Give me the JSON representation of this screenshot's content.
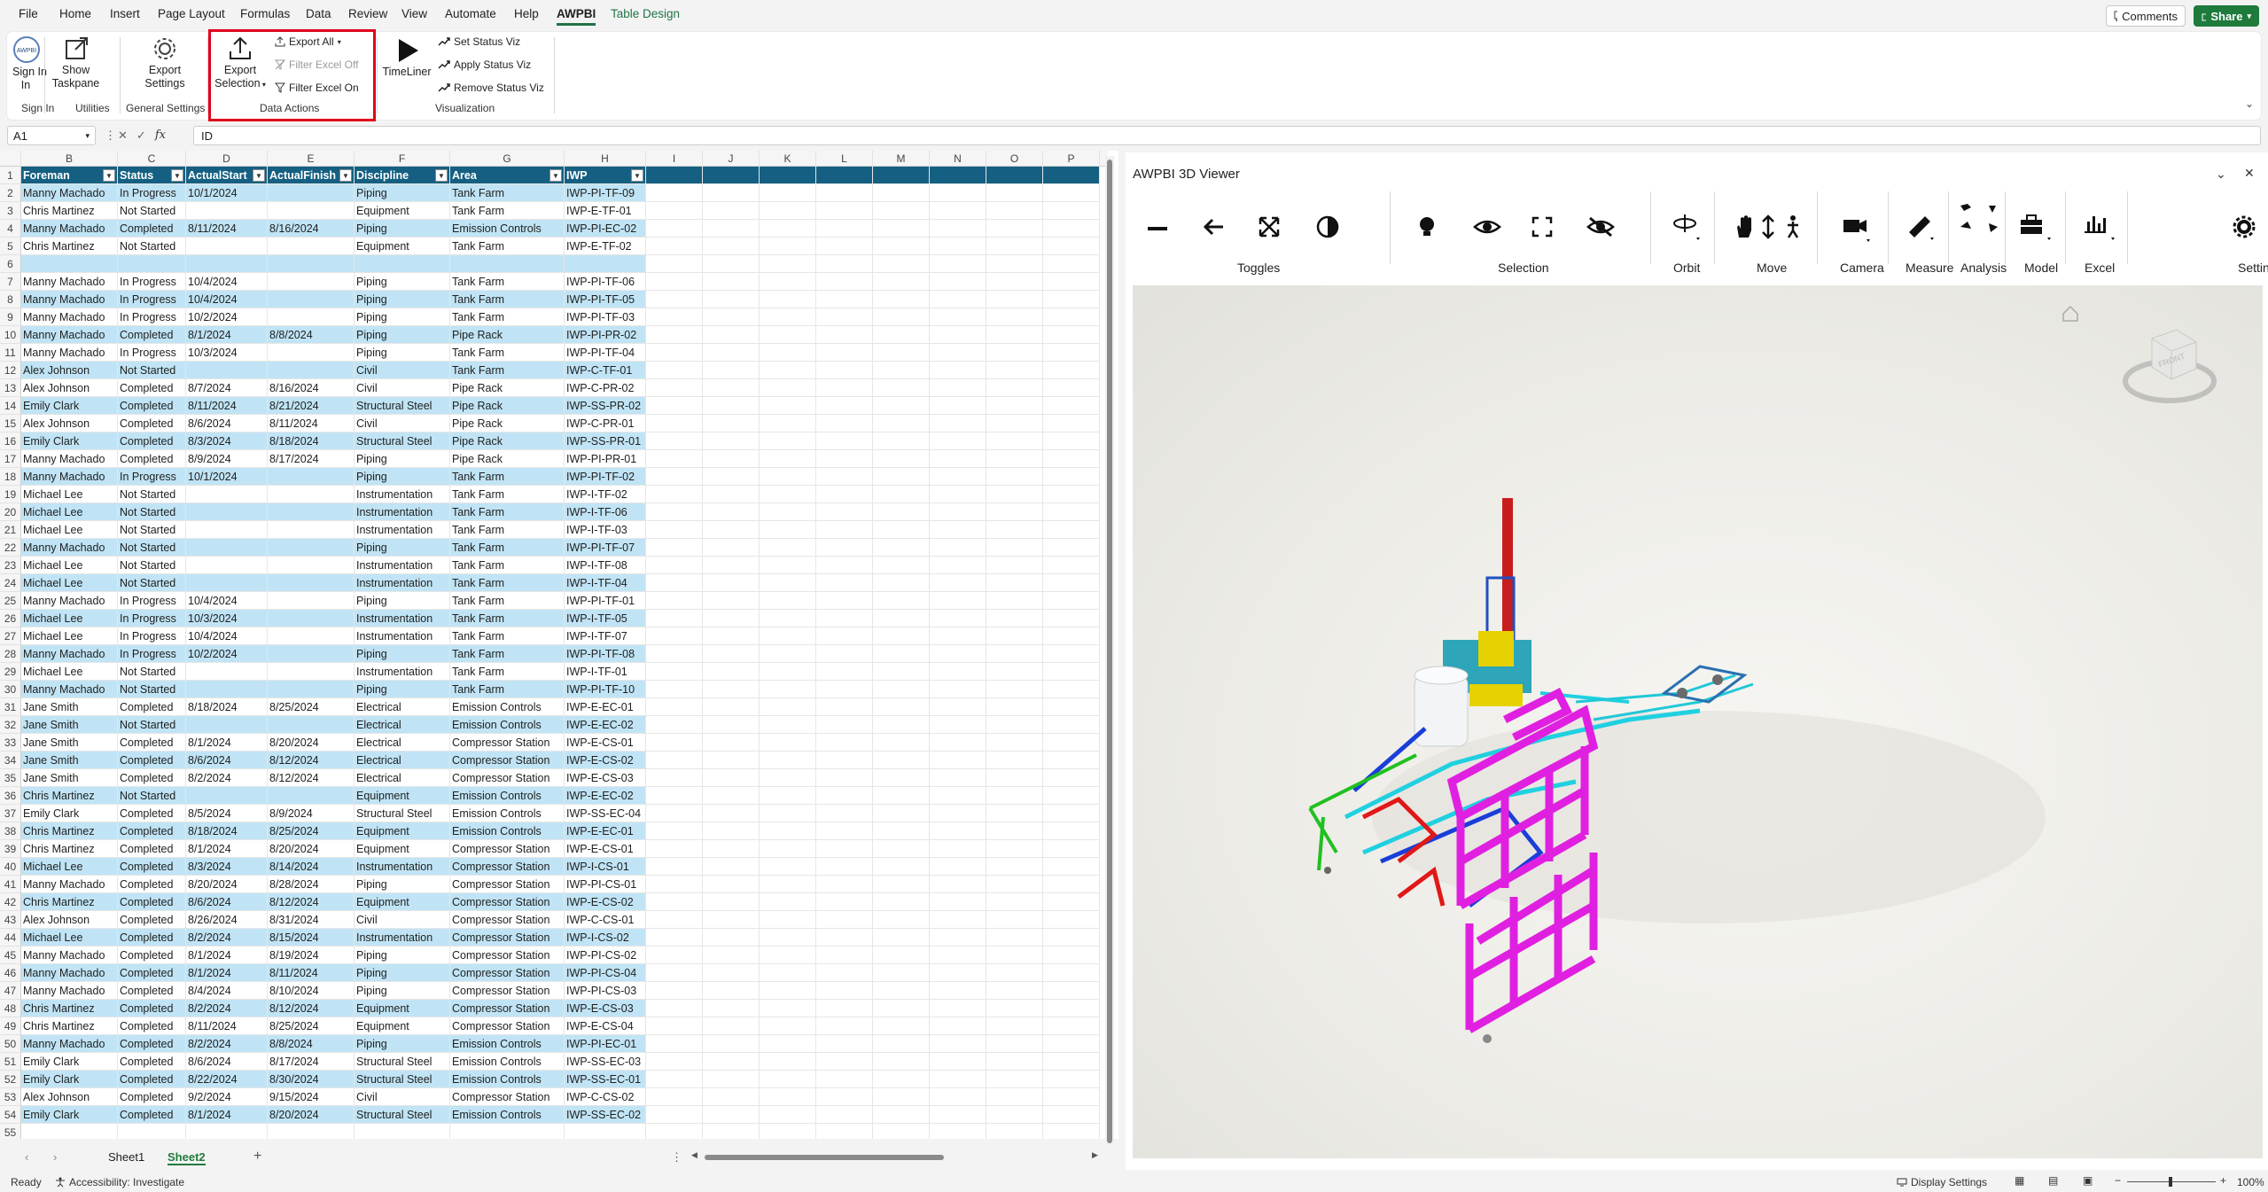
{
  "menu": {
    "tabs": [
      "File",
      "Home",
      "Insert",
      "Page Layout",
      "Formulas",
      "Data",
      "Review",
      "View",
      "Automate",
      "Help",
      "AWPBI",
      "Table Design"
    ],
    "comments": "Comments",
    "share": "Share"
  },
  "ribbon": {
    "sign_in": "Sign In",
    "sign_in_line2": "In",
    "show_taskpane_1": "Show",
    "show_taskpane_2": "Taskpane",
    "export_settings_1": "Export",
    "export_settings_2": "Settings",
    "export_selection_1": "Export",
    "export_selection_2": "Selection",
    "export_all": "Export All",
    "filter_excel_off": "Filter Excel Off",
    "filter_excel_on": "Filter Excel On",
    "timeliner": "TimeLiner",
    "set_status_viz": "Set Status Viz",
    "apply_status_viz": "Apply Status Viz",
    "remove_status_viz": "Remove Status Viz",
    "groups": {
      "sign_in": "Sign In",
      "utilities": "Utilities",
      "general_settings": "General Settings",
      "data_actions": "Data Actions",
      "visualization": "Visualization"
    }
  },
  "formula": {
    "namebox": "A1",
    "value": "ID"
  },
  "sheet": {
    "columns": [
      "B",
      "C",
      "D",
      "E",
      "F",
      "G",
      "H",
      "I",
      "J",
      "K",
      "L",
      "M",
      "N",
      "O",
      "P"
    ],
    "headers": [
      "Foreman",
      "Status",
      "ActualStart",
      "ActualFinish",
      "Discipline",
      "Area",
      "IWP"
    ],
    "rows": [
      [
        "Manny Machado",
        "In Progress",
        "10/1/2024",
        "",
        "Piping",
        "Tank Farm",
        "IWP-PI-TF-09"
      ],
      [
        "Chris Martinez",
        "Not Started",
        "",
        "",
        "Equipment",
        "Tank Farm",
        "IWP-E-TF-01"
      ],
      [
        "Manny Machado",
        "Completed",
        "8/11/2024",
        "8/16/2024",
        "Piping",
        "Emission Controls",
        "IWP-PI-EC-02"
      ],
      [
        "Chris Martinez",
        "Not Started",
        "",
        "",
        "Equipment",
        "Tank Farm",
        "IWP-E-TF-02"
      ],
      [
        "",
        "",
        "",
        "",
        "",
        "",
        ""
      ],
      [
        "Manny Machado",
        "In Progress",
        "10/4/2024",
        "",
        "Piping",
        "Tank Farm",
        "IWP-PI-TF-06"
      ],
      [
        "Manny Machado",
        "In Progress",
        "10/4/2024",
        "",
        "Piping",
        "Tank Farm",
        "IWP-PI-TF-05"
      ],
      [
        "Manny Machado",
        "In Progress",
        "10/2/2024",
        "",
        "Piping",
        "Tank Farm",
        "IWP-PI-TF-03"
      ],
      [
        "Manny Machado",
        "Completed",
        "8/1/2024",
        "8/8/2024",
        "Piping",
        "Pipe Rack",
        "IWP-PI-PR-02"
      ],
      [
        "Manny Machado",
        "In Progress",
        "10/3/2024",
        "",
        "Piping",
        "Tank Farm",
        "IWP-PI-TF-04"
      ],
      [
        "Alex Johnson",
        "Not Started",
        "",
        "",
        "Civil",
        "Tank Farm",
        "IWP-C-TF-01"
      ],
      [
        "Alex Johnson",
        "Completed",
        "8/7/2024",
        "8/16/2024",
        "Civil",
        "Pipe Rack",
        "IWP-C-PR-02"
      ],
      [
        "Emily Clark",
        "Completed",
        "8/11/2024",
        "8/21/2024",
        "Structural Steel",
        "Pipe Rack",
        "IWP-SS-PR-02"
      ],
      [
        "Alex Johnson",
        "Completed",
        "8/6/2024",
        "8/11/2024",
        "Civil",
        "Pipe Rack",
        "IWP-C-PR-01"
      ],
      [
        "Emily Clark",
        "Completed",
        "8/3/2024",
        "8/18/2024",
        "Structural Steel",
        "Pipe Rack",
        "IWP-SS-PR-01"
      ],
      [
        "Manny Machado",
        "Completed",
        "8/9/2024",
        "8/17/2024",
        "Piping",
        "Pipe Rack",
        "IWP-PI-PR-01"
      ],
      [
        "Manny Machado",
        "In Progress",
        "10/1/2024",
        "",
        "Piping",
        "Tank Farm",
        "IWP-PI-TF-02"
      ],
      [
        "Michael Lee",
        "Not Started",
        "",
        "",
        "Instrumentation",
        "Tank Farm",
        "IWP-I-TF-02"
      ],
      [
        "Michael Lee",
        "Not Started",
        "",
        "",
        "Instrumentation",
        "Tank Farm",
        "IWP-I-TF-06"
      ],
      [
        "Michael Lee",
        "Not Started",
        "",
        "",
        "Instrumentation",
        "Tank Farm",
        "IWP-I-TF-03"
      ],
      [
        "Manny Machado",
        "Not Started",
        "",
        "",
        "Piping",
        "Tank Farm",
        "IWP-PI-TF-07"
      ],
      [
        "Michael Lee",
        "Not Started",
        "",
        "",
        "Instrumentation",
        "Tank Farm",
        "IWP-I-TF-08"
      ],
      [
        "Michael Lee",
        "Not Started",
        "",
        "",
        "Instrumentation",
        "Tank Farm",
        "IWP-I-TF-04"
      ],
      [
        "Manny Machado",
        "In Progress",
        "10/4/2024",
        "",
        "Piping",
        "Tank Farm",
        "IWP-PI-TF-01"
      ],
      [
        "Michael Lee",
        "In Progress",
        "10/3/2024",
        "",
        "Instrumentation",
        "Tank Farm",
        "IWP-I-TF-05"
      ],
      [
        "Michael Lee",
        "In Progress",
        "10/4/2024",
        "",
        "Instrumentation",
        "Tank Farm",
        "IWP-I-TF-07"
      ],
      [
        "Manny Machado",
        "In Progress",
        "10/2/2024",
        "",
        "Piping",
        "Tank Farm",
        "IWP-PI-TF-08"
      ],
      [
        "Michael Lee",
        "Not Started",
        "",
        "",
        "Instrumentation",
        "Tank Farm",
        "IWP-I-TF-01"
      ],
      [
        "Manny Machado",
        "Not Started",
        "",
        "",
        "Piping",
        "Tank Farm",
        "IWP-PI-TF-10"
      ],
      [
        "Jane Smith",
        "Completed",
        "8/18/2024",
        "8/25/2024",
        "Electrical",
        "Emission Controls",
        "IWP-E-EC-01"
      ],
      [
        "Jane Smith",
        "Not Started",
        "",
        "",
        "Electrical",
        "Emission Controls",
        "IWP-E-EC-02"
      ],
      [
        "Jane Smith",
        "Completed",
        "8/1/2024",
        "8/20/2024",
        "Electrical",
        "Compressor Station",
        "IWP-E-CS-01"
      ],
      [
        "Jane Smith",
        "Completed",
        "8/6/2024",
        "8/12/2024",
        "Electrical",
        "Compressor Station",
        "IWP-E-CS-02"
      ],
      [
        "Jane Smith",
        "Completed",
        "8/2/2024",
        "8/12/2024",
        "Electrical",
        "Compressor Station",
        "IWP-E-CS-03"
      ],
      [
        "Chris Martinez",
        "Not Started",
        "",
        "",
        "Equipment",
        "Emission Controls",
        "IWP-E-EC-02"
      ],
      [
        "Emily Clark",
        "Completed",
        "8/5/2024",
        "8/9/2024",
        "Structural Steel",
        "Emission Controls",
        "IWP-SS-EC-04"
      ],
      [
        "Chris Martinez",
        "Completed",
        "8/18/2024",
        "8/25/2024",
        "Equipment",
        "Emission Controls",
        "IWP-E-EC-01"
      ],
      [
        "Chris Martinez",
        "Completed",
        "8/1/2024",
        "8/20/2024",
        "Equipment",
        "Compressor Station",
        "IWP-E-CS-01"
      ],
      [
        "Michael Lee",
        "Completed",
        "8/3/2024",
        "8/14/2024",
        "Instrumentation",
        "Compressor Station",
        "IWP-I-CS-01"
      ],
      [
        "Manny Machado",
        "Completed",
        "8/20/2024",
        "8/28/2024",
        "Piping",
        "Compressor Station",
        "IWP-PI-CS-01"
      ],
      [
        "Chris Martinez",
        "Completed",
        "8/6/2024",
        "8/12/2024",
        "Equipment",
        "Compressor Station",
        "IWP-E-CS-02"
      ],
      [
        "Alex Johnson",
        "Completed",
        "8/26/2024",
        "8/31/2024",
        "Civil",
        "Compressor Station",
        "IWP-C-CS-01"
      ],
      [
        "Michael Lee",
        "Completed",
        "8/2/2024",
        "8/15/2024",
        "Instrumentation",
        "Compressor Station",
        "IWP-I-CS-02"
      ],
      [
        "Manny Machado",
        "Completed",
        "8/1/2024",
        "8/19/2024",
        "Piping",
        "Compressor Station",
        "IWP-PI-CS-02"
      ],
      [
        "Manny Machado",
        "Completed",
        "8/1/2024",
        "8/11/2024",
        "Piping",
        "Compressor Station",
        "IWP-PI-CS-04"
      ],
      [
        "Manny Machado",
        "Completed",
        "8/4/2024",
        "8/10/2024",
        "Piping",
        "Compressor Station",
        "IWP-PI-CS-03"
      ],
      [
        "Chris Martinez",
        "Completed",
        "8/2/2024",
        "8/12/2024",
        "Equipment",
        "Compressor Station",
        "IWP-E-CS-03"
      ],
      [
        "Chris Martinez",
        "Completed",
        "8/11/2024",
        "8/25/2024",
        "Equipment",
        "Compressor Station",
        "IWP-E-CS-04"
      ],
      [
        "Manny Machado",
        "Completed",
        "8/2/2024",
        "8/8/2024",
        "Piping",
        "Emission Controls",
        "IWP-PI-EC-01"
      ],
      [
        "Emily Clark",
        "Completed",
        "8/6/2024",
        "8/17/2024",
        "Structural Steel",
        "Emission Controls",
        "IWP-SS-EC-03"
      ],
      [
        "Emily Clark",
        "Completed",
        "8/22/2024",
        "8/30/2024",
        "Structural Steel",
        "Emission Controls",
        "IWP-SS-EC-01"
      ],
      [
        "Alex Johnson",
        "Completed",
        "9/2/2024",
        "9/15/2024",
        "Civil",
        "Compressor Station",
        "IWP-C-CS-02"
      ],
      [
        "Emily Clark",
        "Completed",
        "8/1/2024",
        "8/20/2024",
        "Structural Steel",
        "Emission Controls",
        "IWP-SS-EC-02"
      ]
    ],
    "tabs": [
      "Sheet1",
      "Sheet2"
    ],
    "active_tab": "Sheet2"
  },
  "status": {
    "ready": "Ready",
    "accessibility": "Accessibility: Investigate",
    "display_settings": "Display Settings",
    "zoom": "100%"
  },
  "viewer": {
    "title": "AWPBI 3D Viewer",
    "groups": [
      "Toggles",
      "Selection",
      "Orbit",
      "Move",
      "Camera",
      "Measure",
      "Analysis",
      "Model",
      "Excel",
      "Setting"
    ],
    "cube_label": "FRONT"
  },
  "colors": {
    "header": "#156082",
    "band": "#c0e4f5",
    "accent": "#1e7b3c",
    "highlight": "#e0001b"
  }
}
